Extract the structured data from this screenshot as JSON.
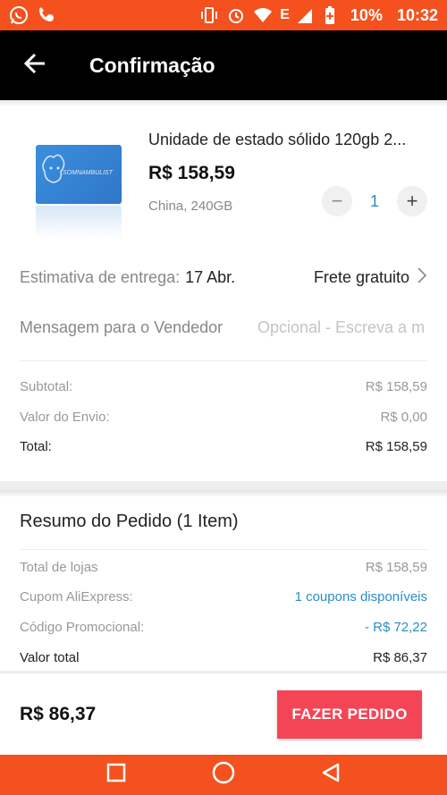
{
  "status_bar": {
    "battery": "10%",
    "time": "10:32",
    "network": "E",
    "left_icons": [
      "whatsapp-icon",
      "phone-missed-icon"
    ],
    "right_icons": [
      "vibrate-icon",
      "alarm-icon",
      "wifi-icon",
      "signal-icon",
      "battery-icon"
    ]
  },
  "header": {
    "title": "Confirmação"
  },
  "product": {
    "title": "Unidade de estado sólido 120gb 2...",
    "price": "R$ 158,59",
    "variant": "China, 240GB",
    "quantity": "1",
    "image_brand": "SOMNAMBULIST"
  },
  "delivery": {
    "label": "Estimativa de entrega:",
    "date": "17 Abr.",
    "shipping": "Frete gratuito"
  },
  "message": {
    "label": "Mensagem para o Vendedor",
    "placeholder": "Opcional - Escreva a m"
  },
  "summary": {
    "subtotal_label": "Subtotal:",
    "subtotal_value": "R$ 158,59",
    "shipping_label": "Valor do Envio:",
    "shipping_value": "R$ 0,00",
    "total_label": "Total:",
    "total_value": "R$ 158,59"
  },
  "order_summary": {
    "title": "Resumo do Pedido (1 Item)",
    "stores_label": "Total de lojas",
    "stores_value": "R$ 158,59",
    "coupon_label": "Cupom AliExpress:",
    "coupon_value": "1 coupons disponíveis",
    "promo_label": "Código Promocional:",
    "promo_value": "- R$ 72,22",
    "final_label": "Valor total",
    "final_value": "R$ 86,37"
  },
  "footer": {
    "amount": "R$ 86,37",
    "button": "FAZER PEDIDO"
  },
  "colors": {
    "brand_orange": "#f4511e",
    "order_button": "#f44556",
    "link_blue": "#2a8dc7",
    "appbar": "#000000"
  }
}
